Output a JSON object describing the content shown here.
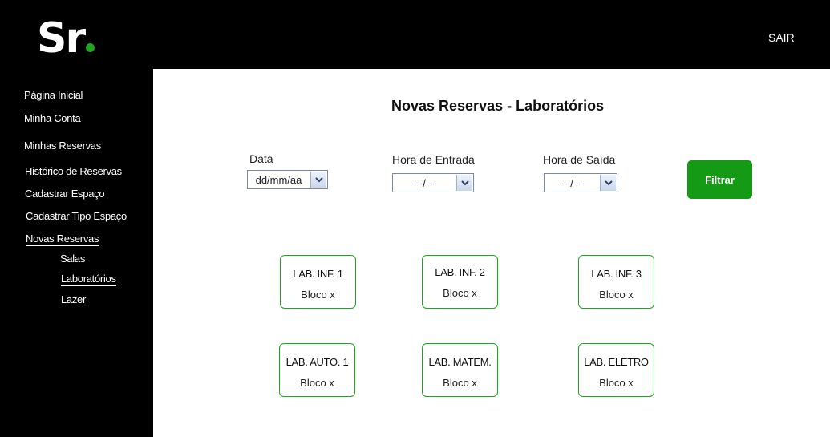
{
  "header": {
    "logo_text": "Sr",
    "logout_label": "SAIR"
  },
  "sidebar": {
    "items": [
      {
        "label": "Página Inicial"
      },
      {
        "label": "Minha Conta"
      },
      {
        "label": "Minhas Reservas"
      },
      {
        "label": "Histórico de Reservas"
      },
      {
        "label": "Cadastrar Espaço"
      },
      {
        "label": "Cadastrar Tipo Espaço"
      },
      {
        "label": "Novas Reservas"
      }
    ],
    "sub_items": [
      {
        "label": "Salas"
      },
      {
        "label": "Laboratórios"
      },
      {
        "label": "Lazer"
      }
    ]
  },
  "main": {
    "title": "Novas Reservas - Laboratórios",
    "filters": {
      "date_label": "Data",
      "date_value": "dd/mm/aa",
      "entry_label": "Hora de Entrada",
      "entry_value": "--/--",
      "exit_label": "Hora de Saída",
      "exit_value": "--/--",
      "filter_button": "Filtrar"
    },
    "labs": [
      {
        "name": "LAB. INF. 1",
        "block": "Bloco x"
      },
      {
        "name": "LAB. INF. 2",
        "block": "Bloco x"
      },
      {
        "name": "LAB. INF. 3",
        "block": "Bloco x"
      },
      {
        "name": "LAB. AUTO. 1",
        "block": "Bloco x"
      },
      {
        "name": "LAB. MATEM.",
        "block": "Bloco x"
      },
      {
        "name": "LAB. ELETRO",
        "block": "Bloco x"
      }
    ]
  },
  "colors": {
    "accent": "#149a14",
    "card_border": "#1fa51f",
    "background_dark": "#000000"
  },
  "icons": {
    "dropdown": "chevron-down-icon"
  }
}
